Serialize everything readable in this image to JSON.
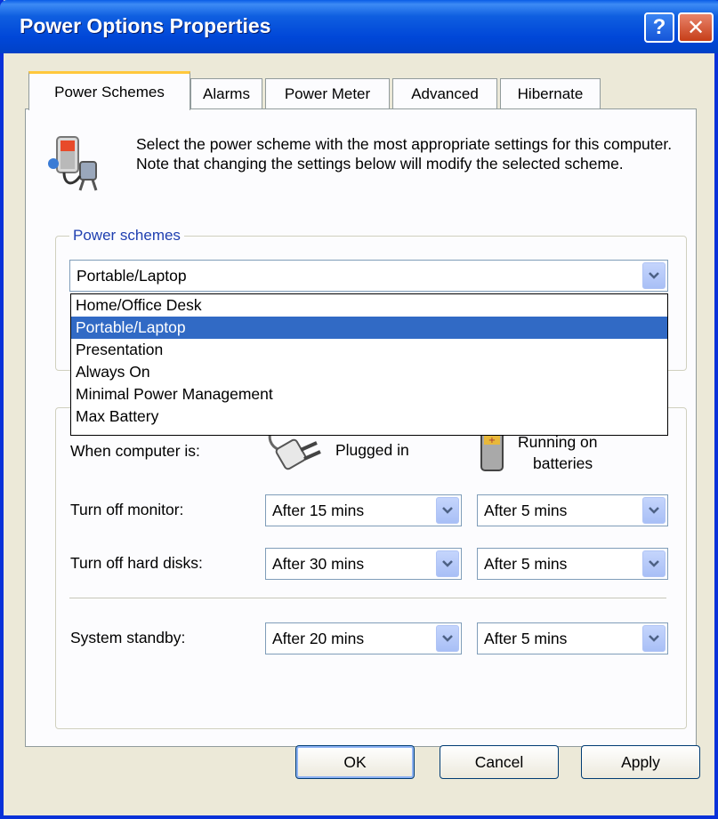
{
  "window": {
    "title": "Power Options Properties"
  },
  "titlebar_buttons": {
    "help": "?",
    "close": "✕"
  },
  "tabs": [
    {
      "label": "Power Schemes",
      "active": true
    },
    {
      "label": "Alarms",
      "active": false
    },
    {
      "label": "Power Meter",
      "active": false
    },
    {
      "label": "Advanced",
      "active": false
    },
    {
      "label": "Hibernate",
      "active": false
    }
  ],
  "description": "Select the power scheme with the most appropriate settings for this computer. Note that changing the settings below will modify the selected scheme.",
  "power_schemes": {
    "group_label": "Power schemes",
    "selected": "Portable/Laptop",
    "options": [
      "Home/Office Desk",
      "Portable/Laptop",
      "Presentation",
      "Always On",
      "Minimal Power Management",
      "Max Battery"
    ],
    "highlighted_index": 1
  },
  "settings": {
    "when_label": "When computer is:",
    "plugged_in_label": "Plugged in",
    "batteries_label_line1": "Running on",
    "batteries_label_line2": "batteries",
    "rows": [
      {
        "label": "Turn off monitor:",
        "plugged": "After 15 mins",
        "battery": "After 5 mins"
      },
      {
        "label": "Turn off hard disks:",
        "plugged": "After 30 mins",
        "battery": "After 5 mins"
      },
      {
        "label": "System standby:",
        "plugged": "After 20 mins",
        "battery": "After 5 mins"
      }
    ]
  },
  "buttons": {
    "ok": "OK",
    "cancel": "Cancel",
    "apply": "Apply"
  },
  "icons": {
    "app": "power-options-icon",
    "plug": "plug-icon",
    "battery": "battery-icon",
    "dropdown": "chevron-down-icon"
  },
  "colors": {
    "titlebar": "#0047d8",
    "selection": "#316ac5",
    "tab_highlight": "#ffc83c",
    "group_label": "#1f3fb0"
  }
}
